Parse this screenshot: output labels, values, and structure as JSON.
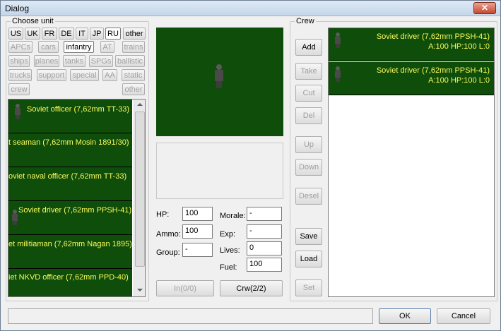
{
  "window": {
    "title": "Dialog",
    "close_label": "✕"
  },
  "choose_unit": {
    "legend": "Choose unit",
    "nations": [
      "US",
      "UK",
      "FR",
      "DE",
      "IT",
      "JP",
      "RU",
      "other"
    ],
    "selected_nation": "RU",
    "categories_row1": [
      "APCs",
      "cars",
      "infantry",
      "AT",
      "trains"
    ],
    "categories_row2": [
      "ships",
      "planes",
      "tanks",
      "SPGs",
      "ballistic"
    ],
    "categories_row3": [
      "trucks",
      "support",
      "special",
      "AA",
      "static"
    ],
    "categories_row4": [
      "crew",
      "other"
    ],
    "selected_category": "infantry",
    "units": [
      "Soviet officer (7,62mm TT-33)",
      "t seaman (7,62mm Mosin 1891/30)",
      "oviet naval officer (7,62mm TT-33)",
      "Soviet driver (7,62mm PPSH-41)",
      "et militiaman (7,62mm Nagan 1895)",
      "iet NKVD officer (7,62mm PPD-40)"
    ]
  },
  "stats": {
    "hp_label": "HP:",
    "hp": "100",
    "ammo_label": "Ammo:",
    "ammo": "100",
    "group_label": "Group:",
    "group": "-",
    "morale_label": "Morale:",
    "morale": "-",
    "exp_label": "Exp:",
    "exp": "-",
    "lives_label": "Lives:",
    "lives": "0",
    "fuel_label": "Fuel:",
    "fuel": "100",
    "in_label": "In(0/0)",
    "crw_label": "Crw(2/2)"
  },
  "crew": {
    "legend": "Crew",
    "buttons": {
      "add": "Add",
      "take": "Take",
      "cut": "Cut",
      "del": "Del",
      "up": "Up",
      "down": "Down",
      "desel": "Desel",
      "save": "Save",
      "load": "Load",
      "set": "Set"
    },
    "members": [
      {
        "name": "Soviet driver (7,62mm PPSH-41)",
        "stats": "A:100 HP:100 L:0"
      },
      {
        "name": "Soviet driver (7,62mm PPSH-41)",
        "stats": "A:100 HP:100 L:0"
      }
    ]
  },
  "footer": {
    "status": "",
    "ok_label": "OK",
    "cancel_label": "Cancel"
  },
  "colors": {
    "unit_bg": "#0f4d0a",
    "unit_text": "#fbfb5c"
  }
}
